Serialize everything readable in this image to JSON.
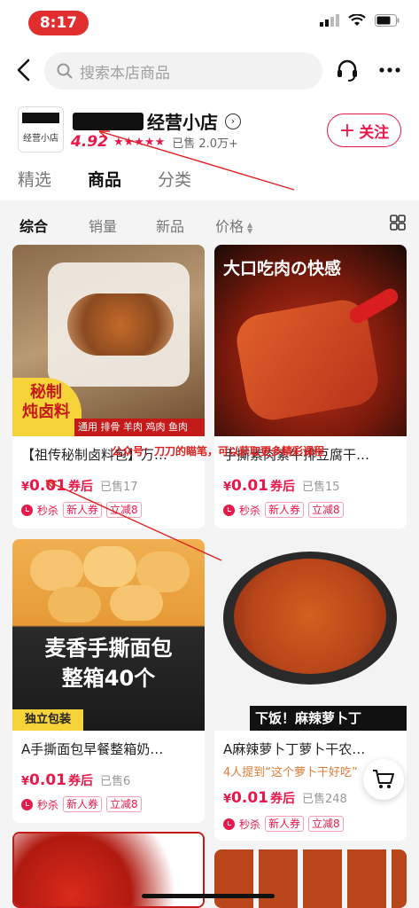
{
  "status_bar": {
    "time": "8:17"
  },
  "header": {
    "search_placeholder": "搜索本店商品"
  },
  "shop": {
    "name": "经营小店",
    "logo_text": "经营小店",
    "rating": "4.92",
    "rating_stars": 5,
    "sold": "已售 2.0万+",
    "follow_label": "关注"
  },
  "tabs": [
    {
      "label": "精选",
      "active": false
    },
    {
      "label": "商品",
      "active": true
    },
    {
      "label": "分类",
      "active": false
    }
  ],
  "filters": [
    {
      "label": "综合",
      "active": true
    },
    {
      "label": "销量",
      "active": false
    },
    {
      "label": "新品",
      "active": false
    },
    {
      "label": "价格",
      "active": false
    }
  ],
  "products": [
    {
      "title": "【祖传秘制卤料包】万…",
      "price": "0.01",
      "currency": "¥",
      "after": "券后",
      "sold": "已售17",
      "tags": [
        "秒杀",
        "新人券",
        "立减8"
      ],
      "image_badge": "秘制炖卤料",
      "badge_line1": "秘制",
      "badge_line2": "炖卤料",
      "image_caption": "通用 排骨 羊肉 鸡肉 鱼肉"
    },
    {
      "title": "手撕素肉素牛排豆腐干…",
      "price": "0.01",
      "currency": "¥",
      "after": "券后",
      "sold": "已售15",
      "tags": [
        "秒杀",
        "新人券",
        "立减8"
      ],
      "image_caption": "大口吃肉の快感"
    },
    {
      "title": "A手撕面包早餐整箱奶…",
      "price": "0.01",
      "currency": "¥",
      "after": "券后",
      "sold": "已售6",
      "tags": [
        "秒杀",
        "新人券",
        "立减8"
      ],
      "image_caption_line1": "麦香手撕面包",
      "image_caption_line2": "整箱40个",
      "image_badge": "独立包装"
    },
    {
      "title": "A麻辣萝卜丁萝卜干农…",
      "promo": "4人提到“这个萝卜干好吃”",
      "price": "0.01",
      "currency": "¥",
      "after": "券后",
      "sold": "已售248",
      "tags": [
        "秒杀",
        "新人券",
        "立减8"
      ],
      "image_caption": "下饭！麻辣萝卜丁"
    }
  ],
  "annotation_text": "公众号：刀刀的瞄笔，可以获取更多精彩课程",
  "colors": {
    "accent": "#e8194a",
    "status_pill": "#e02e2e"
  }
}
